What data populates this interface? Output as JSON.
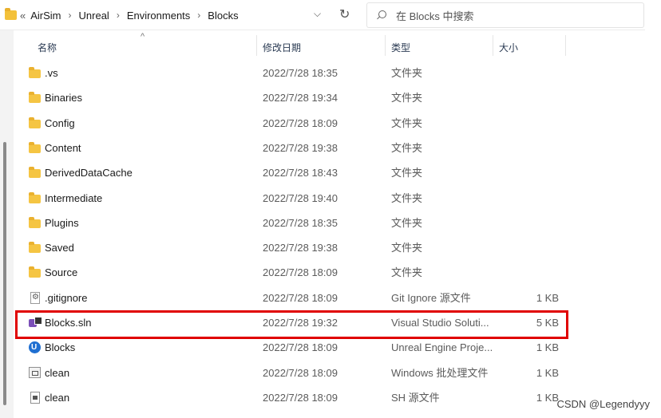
{
  "addressbar": {
    "crumbs": [
      "AirSim",
      "Unreal",
      "Environments",
      "Blocks"
    ],
    "overflow": "«",
    "sep": "›",
    "dropdown": "⌵",
    "refresh": "↻"
  },
  "search": {
    "placeholder": "在 Blocks 中搜索"
  },
  "columns": {
    "name": "名称",
    "date": "修改日期",
    "type": "类型",
    "size": "大小",
    "sort_caret": "^"
  },
  "files": [
    {
      "name": ".vs",
      "date": "2022/7/28 18:35",
      "type": "文件夹",
      "size": "",
      "icon": "folder-icon"
    },
    {
      "name": "Binaries",
      "date": "2022/7/28 19:34",
      "type": "文件夹",
      "size": "",
      "icon": "folder-icon"
    },
    {
      "name": "Config",
      "date": "2022/7/28 18:09",
      "type": "文件夹",
      "size": "",
      "icon": "folder-icon"
    },
    {
      "name": "Content",
      "date": "2022/7/28 19:38",
      "type": "文件夹",
      "size": "",
      "icon": "folder-icon"
    },
    {
      "name": "DerivedDataCache",
      "date": "2022/7/28 18:43",
      "type": "文件夹",
      "size": "",
      "icon": "folder-icon"
    },
    {
      "name": "Intermediate",
      "date": "2022/7/28 19:40",
      "type": "文件夹",
      "size": "",
      "icon": "folder-icon"
    },
    {
      "name": "Plugins",
      "date": "2022/7/28 18:35",
      "type": "文件夹",
      "size": "",
      "icon": "folder-icon"
    },
    {
      "name": "Saved",
      "date": "2022/7/28 19:38",
      "type": "文件夹",
      "size": "",
      "icon": "folder-icon"
    },
    {
      "name": "Source",
      "date": "2022/7/28 18:09",
      "type": "文件夹",
      "size": "",
      "icon": "folder-icon"
    },
    {
      "name": ".gitignore",
      "date": "2022/7/28 18:09",
      "type": "Git Ignore 源文件",
      "size": "1 KB",
      "icon": "gitignore-file-icon"
    },
    {
      "name": "Blocks.sln",
      "date": "2022/7/28 19:32",
      "type": "Visual Studio Soluti...",
      "size": "5 KB",
      "icon": "visual-studio-solution-icon"
    },
    {
      "name": "Blocks",
      "date": "2022/7/28 18:09",
      "type": "Unreal Engine Proje...",
      "size": "1 KB",
      "icon": "unreal-engine-icon"
    },
    {
      "name": "clean",
      "date": "2022/7/28 18:09",
      "type": "Windows 批处理文件",
      "size": "1 KB",
      "icon": "batch-file-icon"
    },
    {
      "name": "clean",
      "date": "2022/7/28 18:09",
      "type": "SH 源文件",
      "size": "1 KB",
      "icon": "sh-file-icon"
    }
  ],
  "watermark": "CSDN @Legendyyy",
  "colors": {
    "highlight": "#e00000",
    "folder": "#f5c543",
    "scrollbar": "#8a8a8a"
  }
}
